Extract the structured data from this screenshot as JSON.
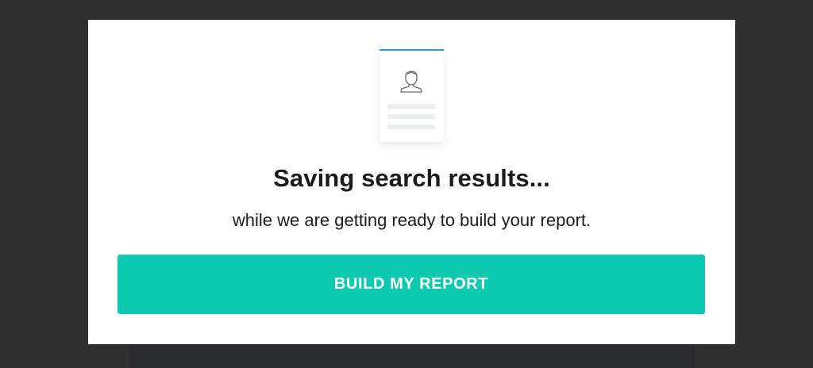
{
  "colors": {
    "backdrop": "#303030",
    "modal_background": "#ffffff",
    "accent_bar": "#1fa3d9",
    "button_background": "#0cc9b0",
    "button_text": "#ffffff"
  },
  "illustration": {
    "icon": "user-profile-document-icon"
  },
  "modal": {
    "title": "Saving search results...",
    "subtitle": "while we are getting ready to build your report.",
    "button_label": "BUILD MY REPORT"
  }
}
